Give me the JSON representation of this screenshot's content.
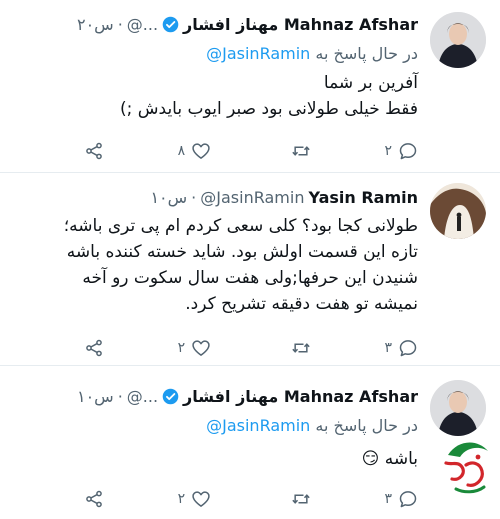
{
  "tweets": [
    {
      "name": "Mahnaz Afshar مهناز افشار",
      "handle": "@...",
      "dot": "·",
      "time": "۲۰س",
      "verified": true,
      "reply_prefix": "در حال پاسخ به",
      "reply_to": "@JasinRamin",
      "lines": [
        "آفرین بر شما",
        "فقط خیلی طولانی بود صبر ایوب بایدش ;)"
      ],
      "reply_count": "۲",
      "retweet_count": "",
      "like_count": "۸"
    },
    {
      "name": "Yasin Ramin",
      "handle": "@JasinRamin",
      "dot": "·",
      "time": "۱۰س",
      "verified": false,
      "lines": [
        "طولانی کجا بود؟ کلی سعی کردم ام پی تری باشه؛",
        "تازه این قسمت اولش بود. شاید خسته کننده باشه",
        "شنیدن این حرفها;ولی هفت سال سکوت رو آخه",
        "نمیشه تو هفت دقیقه تشریح کرد."
      ],
      "reply_count": "۳",
      "retweet_count": "",
      "like_count": "۲"
    },
    {
      "name": "Mahnaz Afshar مهناز افشار",
      "handle": "@...",
      "dot": "·",
      "time": "۱۰س",
      "verified": true,
      "reply_prefix": "در حال پاسخ به",
      "reply_to": "@JasinRamin",
      "lines": [
        "باشه 😏"
      ],
      "reply_count": "۳",
      "retweet_count": "",
      "like_count": "۲"
    }
  ],
  "icons": {
    "reply": "reply-icon",
    "retweet": "retweet-icon",
    "like": "heart-icon",
    "share": "share-icon",
    "verified": "verified-badge-icon"
  },
  "colors": {
    "verified": "#1d9bf0",
    "mention": "#1d9bf0",
    "muted": "#536471"
  }
}
